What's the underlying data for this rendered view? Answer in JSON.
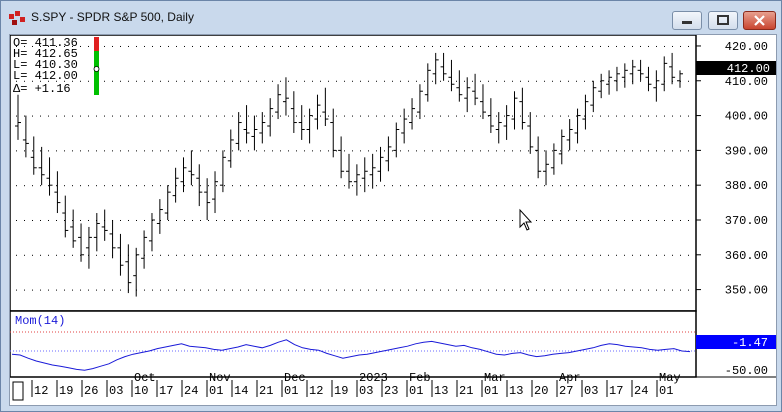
{
  "window": {
    "title": "S.SPY - SPDR S&P 500, Daily"
  },
  "quote": {
    "open": "O= 411.36",
    "high": "H= 412.65",
    "low": "L= 410.30",
    "last": "L= 412.00",
    "change": "Δ=  +1.16"
  },
  "price_axis": {
    "ticks": [
      "420.00",
      "410.00",
      "400.00",
      "390.00",
      "380.00",
      "370.00",
      "360.00",
      "350.00"
    ],
    "current": "412.00"
  },
  "indicator": {
    "label": "Mom(14)",
    "value_label": "-1.47",
    "ticks": [
      "-50.00"
    ]
  },
  "date_axis": {
    "days": [
      "12",
      "19",
      "26",
      "03",
      "10",
      "17",
      "24",
      "01",
      "14",
      "21",
      "01",
      "12",
      "19",
      "03",
      "23",
      "01",
      "13",
      "21",
      "01",
      "13",
      "20",
      "27",
      "03",
      "17",
      "24",
      "01"
    ],
    "months": [
      "Oct",
      "Nov",
      "Dec",
      "2023",
      "Feb",
      "Mar",
      "Apr",
      "May"
    ]
  },
  "colors": {
    "up_indicator": "#00c000",
    "down_indicator": "#e02020",
    "momentum_line": "#1a1ad8",
    "bars": "#000000",
    "selected_value_bg": "#0000ff",
    "window_frame": "#c9d9ec"
  },
  "icons": {
    "app": "chart-app-icon",
    "minimize": "minimize-icon",
    "maximize": "maximize-icon",
    "close": "close-icon",
    "cursor": "mouse-cursor-icon"
  },
  "chart_data": {
    "type": "ohlc",
    "series": [
      {
        "values": [
          [
            397,
            406,
            393,
            398
          ],
          [
            393,
            400,
            388,
            392
          ],
          [
            388,
            394,
            383,
            385
          ],
          [
            385,
            391,
            380,
            383
          ],
          [
            382,
            388,
            377,
            380
          ],
          [
            378,
            384,
            372,
            375
          ],
          [
            372,
            377,
            365,
            367
          ],
          [
            368,
            373,
            362,
            364
          ],
          [
            365,
            369,
            358,
            360
          ],
          [
            362,
            368,
            356,
            365
          ],
          [
            365,
            372,
            361,
            369
          ],
          [
            368,
            373,
            364,
            367
          ],
          [
            366,
            370,
            359,
            362
          ],
          [
            362,
            366,
            354,
            357
          ],
          [
            358,
            363,
            349,
            352
          ],
          [
            354,
            362,
            348,
            360
          ],
          [
            359,
            367,
            356,
            365
          ],
          [
            364,
            372,
            361,
            370
          ],
          [
            369,
            376,
            366,
            373
          ],
          [
            372,
            380,
            370,
            378
          ],
          [
            377,
            385,
            375,
            382
          ],
          [
            381,
            388,
            378,
            385
          ],
          [
            384,
            390,
            380,
            383
          ],
          [
            382,
            386,
            374,
            378
          ],
          [
            378,
            382,
            370,
            375
          ],
          [
            376,
            384,
            372,
            381
          ],
          [
            380,
            390,
            378,
            388
          ],
          [
            387,
            396,
            385,
            393
          ],
          [
            392,
            401,
            390,
            398
          ],
          [
            396,
            403,
            392,
            395
          ],
          [
            394,
            400,
            390,
            396
          ],
          [
            395,
            401,
            392,
            398
          ],
          [
            397,
            405,
            394,
            402
          ],
          [
            401,
            409,
            399,
            406
          ],
          [
            404,
            411,
            400,
            405
          ],
          [
            402,
            407,
            395,
            398
          ],
          [
            398,
            403,
            393,
            396
          ],
          [
            396,
            402,
            392,
            400
          ],
          [
            399,
            406,
            396,
            403
          ],
          [
            401,
            408,
            397,
            399
          ],
          [
            398,
            402,
            388,
            390
          ],
          [
            390,
            394,
            382,
            384
          ],
          [
            384,
            389,
            379,
            381
          ],
          [
            381,
            386,
            377,
            383
          ],
          [
            382,
            388,
            378,
            384
          ],
          [
            383,
            389,
            379,
            385
          ],
          [
            384,
            391,
            381,
            388
          ],
          [
            387,
            394,
            384,
            391
          ],
          [
            390,
            398,
            388,
            396
          ],
          [
            395,
            402,
            392,
            399
          ],
          [
            398,
            405,
            396,
            402
          ],
          [
            401,
            409,
            399,
            407
          ],
          [
            406,
            415,
            404,
            413
          ],
          [
            412,
            418,
            409,
            416
          ],
          [
            414,
            418,
            410,
            412
          ],
          [
            411,
            416,
            407,
            409
          ],
          [
            408,
            413,
            404,
            406
          ],
          [
            405,
            411,
            401,
            408
          ],
          [
            407,
            412,
            403,
            405
          ],
          [
            404,
            409,
            399,
            401
          ],
          [
            400,
            405,
            395,
            397
          ],
          [
            396,
            401,
            392,
            398
          ],
          [
            397,
            403,
            393,
            400
          ],
          [
            399,
            407,
            396,
            405
          ],
          [
            404,
            408,
            396,
            398
          ],
          [
            397,
            401,
            389,
            391
          ],
          [
            390,
            394,
            382,
            384
          ],
          [
            384,
            390,
            380,
            386
          ],
          [
            385,
            392,
            383,
            390
          ],
          [
            389,
            396,
            386,
            394
          ],
          [
            393,
            399,
            390,
            396
          ],
          [
            395,
            402,
            392,
            400
          ],
          [
            399,
            406,
            396,
            404
          ],
          [
            403,
            410,
            401,
            408
          ],
          [
            407,
            412,
            405,
            410
          ],
          [
            409,
            413,
            406,
            411
          ],
          [
            410,
            414,
            407,
            412
          ],
          [
            411,
            415,
            408,
            413
          ],
          [
            412,
            416,
            409,
            414
          ],
          [
            413,
            416,
            410,
            412
          ],
          [
            411,
            414,
            407,
            409
          ],
          [
            408,
            413,
            404,
            410
          ],
          [
            409,
            417,
            407,
            415
          ],
          [
            414,
            418,
            409,
            411
          ],
          [
            410,
            413,
            408,
            412
          ]
        ]
      }
    ],
    "ylim": [
      345,
      422
    ],
    "momentum": {
      "name": "Mom(14)",
      "values": [
        -8,
        -10,
        -18,
        -25,
        -30,
        -35,
        -38,
        -42,
        -46,
        -48,
        -44,
        -38,
        -32,
        -22,
        -14,
        -8,
        -4,
        0,
        6,
        10,
        14,
        18,
        12,
        10,
        8,
        4,
        2,
        6,
        10,
        16,
        12,
        8,
        14,
        22,
        28,
        16,
        8,
        4,
        2,
        -6,
        -12,
        -18,
        -14,
        -10,
        -8,
        -4,
        0,
        4,
        8,
        12,
        18,
        22,
        24,
        20,
        16,
        12,
        14,
        8,
        4,
        -2,
        -8,
        -10,
        -6,
        -4,
        -10,
        -14,
        -12,
        -8,
        -6,
        -4,
        0,
        4,
        8,
        14,
        18,
        16,
        12,
        10,
        8,
        4,
        2,
        4,
        6,
        0,
        -1.47
      ]
    }
  }
}
